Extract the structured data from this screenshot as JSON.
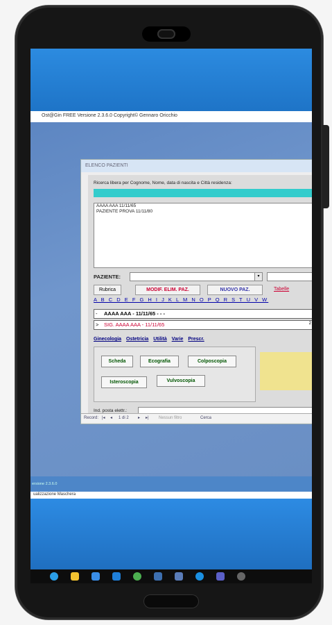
{
  "app": {
    "window_title": "Ost@Gin FREE Versione 2.3.6.0 Copyright© Gennaro Oricchio"
  },
  "dialog": {
    "title": "ELENCO PAZIENTI",
    "search_label": "Ricerca libera per Cognome, Nome, data di nascita e Città residenza:",
    "list_items": [
      "AAAA AAA 11/11/65",
      "PAZIENTE PROVA 11/11/80"
    ],
    "paziente_label": "PAZIENTE:",
    "buttons": {
      "rubrica": "Rubrica",
      "modif_elim": "MODIF. ELIM. PAZ.",
      "nuovo": "NUOVO PAZ.",
      "tabelle": "Tabelle"
    },
    "alphabet": "A B C D E F G H I J K L M N O P Q R S T U V W",
    "record_row_1": "AAAA AAA  -  11/11/65  -  -  -",
    "record_row_2": "SIG. AAAA AAA  -  11/11/65",
    "record_row_2_suffix": "2",
    "tabs": [
      "Ginecologia",
      "Ostetricia",
      "Utilità",
      "Varie",
      "Prescr."
    ],
    "exam_buttons": {
      "scheda": "Scheda",
      "ecografia": "Ecografia",
      "colposcopia": "Colposcopia",
      "isteroscopia": "Isteroscopia",
      "vulvoscopia": "Vulvoscopia"
    },
    "email_label": "Ind. posta elettr.:",
    "status": {
      "record_label": "Record:",
      "record_pos": "1 di 2",
      "filter": "Nessun filtro",
      "search": "Cerca"
    }
  },
  "background_window": {
    "title_fragment": "ersione 2.3.6.0",
    "statusbar": "ualizzazione Maschera"
  },
  "colors": {
    "screen_blue": "#2a86d6",
    "desktop": "#6a8fc4",
    "cyan_bar": "#33cccc",
    "yellow_panel": "#f0e38f",
    "modif_text": "#cc0033",
    "nuovo_text": "#3333aa",
    "exam_text": "#005500"
  },
  "taskbar_icons": [
    "edge-icon",
    "folder-icon",
    "store-icon",
    "mail-icon",
    "chrome-icon",
    "app-icon",
    "app-icon-2",
    "skype-icon",
    "teams-icon",
    "settings-icon"
  ]
}
